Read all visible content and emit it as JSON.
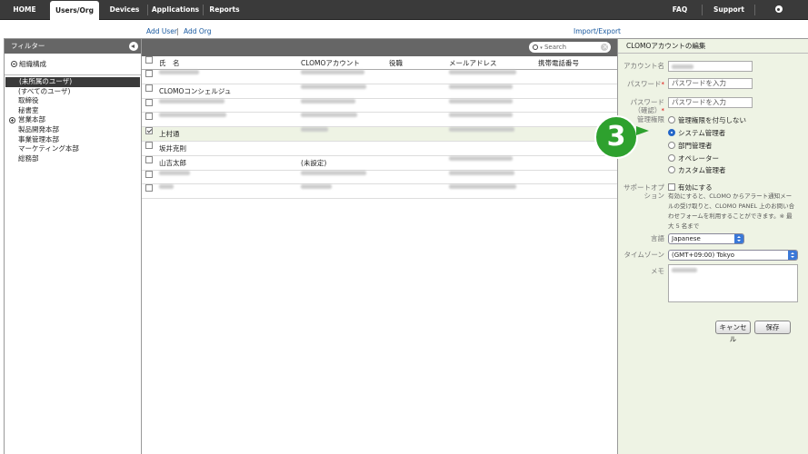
{
  "nav": {
    "tabs": [
      "HOME",
      "Users/Org",
      "Devices",
      "Applications",
      "Reports"
    ],
    "active": "Users/Org",
    "faq": "FAQ",
    "support": "Support",
    "settings": "Settings"
  },
  "links": {
    "add_user": "Add User",
    "add_org": "Add Org",
    "import_export": "Import/Export"
  },
  "filter": {
    "title": "フィルター",
    "section": "組織構成",
    "items": [
      "(未所属のユーザ)",
      "(すべてのユーザ)",
      "取締役",
      "秘書室",
      "営業本部",
      "製品開発本部",
      "事業管理本部",
      "マーケティング本部",
      "総務部"
    ],
    "selected_index": 0
  },
  "search": {
    "placeholder": "Search"
  },
  "table": {
    "columns": [
      "氏　名",
      "CLOMOアカウント",
      "役職",
      "メールアドレス",
      "携帯電話番号"
    ],
    "rows": [
      {
        "name": "",
        "account": "",
        "email": "",
        "checked": false
      },
      {
        "name": "CLOMOコンシェルジュ",
        "account": "",
        "email": "",
        "checked": false
      },
      {
        "name": "",
        "account": "",
        "email": "",
        "checked": false
      },
      {
        "name": "",
        "account": "",
        "email": "",
        "checked": false
      },
      {
        "name": "上村通",
        "account": "",
        "email": "",
        "checked": true
      },
      {
        "name": "坂井克則",
        "account": "",
        "email": "",
        "checked": false
      },
      {
        "name": "山吉太郎",
        "account": "(未設定)",
        "email": "",
        "checked": false
      },
      {
        "name": "",
        "account": "",
        "email": "",
        "checked": false
      },
      {
        "name": "",
        "account": "",
        "email": "",
        "checked": false
      }
    ]
  },
  "edit": {
    "title": "CLOMOアカウントの編集",
    "account_label": "アカウント名",
    "password_label": "パスワード",
    "password_placeholder": "パスワードを入力",
    "password_confirm_label": "パスワード（確認）",
    "password_confirm_placeholder": "パスワードを入力",
    "role_label": "管理権限",
    "roles": [
      "管理権限を付与しない",
      "システム管理者",
      "部門管理者",
      "オペレーター",
      "カスタム管理者"
    ],
    "role_selected": 1,
    "support_label": "サポートオプション",
    "support_checkbox": "有効にする",
    "support_desc": "有効にすると、CLOMO からアラート通知メールの受け取りと、CLOMO PANEL 上のお問い合わせフォームを利用することができます。※ 最大 5 名まで",
    "language_label": "言語",
    "language_value": "Japanese",
    "timezone_label": "タイムゾーン",
    "timezone_value": "(GMT+09:00) Tokyo",
    "memo_label": "メモ",
    "cancel": "キャンセル",
    "save": "保存"
  },
  "step_number": "3"
}
